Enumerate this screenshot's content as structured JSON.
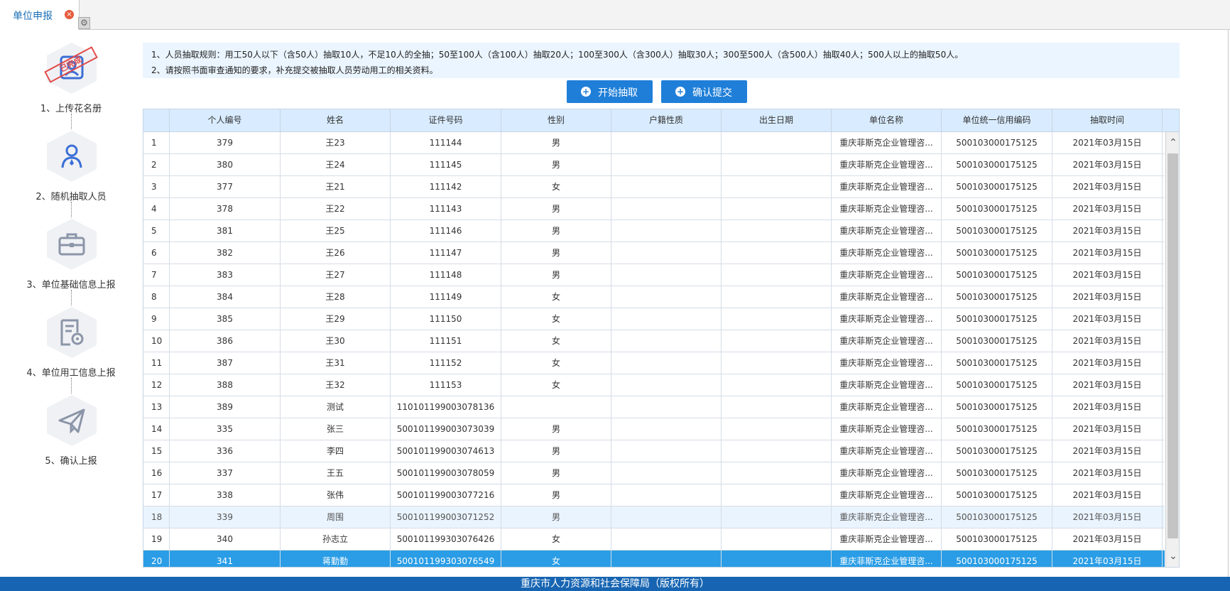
{
  "tab": {
    "title": "单位申报",
    "close": "×",
    "gear": "⚙"
  },
  "steps": [
    {
      "label": "1、上传花名册",
      "icon": "upload-roster-icon",
      "stamp": "已完成"
    },
    {
      "label": "2、随机抽取人员",
      "icon": "person-icon"
    },
    {
      "label": "3、单位基础信息上报",
      "icon": "briefcase-icon"
    },
    {
      "label": "4、单位用工信息上报",
      "icon": "document-gear-icon"
    },
    {
      "label": "5、确认上报",
      "icon": "send-icon"
    }
  ],
  "notice": {
    "line1": "1、人员抽取规则：用工50人以下（含50人）抽取10人，不足10人的全抽；50至100人（含100人）抽取20人；100至300人（含300人）抽取30人；300至500人（含500人）抽取40人；500人以上的抽取50人。",
    "line2": "2、请按照书面审查通知的要求，补充提交被抽取人员劳动用工的相关资料。"
  },
  "buttons": {
    "start": "开始抽取",
    "confirm": "确认提交",
    "plus": "+"
  },
  "columns": [
    "",
    "个人编号",
    "姓名",
    "证件号码",
    "性别",
    "户籍性质",
    "出生日期",
    "单位名称",
    "单位统一信用编码",
    "抽取时间"
  ],
  "rows": [
    [
      "1",
      "379",
      "王23",
      "111144",
      "男",
      "",
      "",
      "重庆菲斯克企业管理咨...",
      "500103000175125",
      "2021年03月15日"
    ],
    [
      "2",
      "380",
      "王24",
      "111145",
      "男",
      "",
      "",
      "重庆菲斯克企业管理咨...",
      "500103000175125",
      "2021年03月15日"
    ],
    [
      "3",
      "377",
      "王21",
      "111142",
      "女",
      "",
      "",
      "重庆菲斯克企业管理咨...",
      "500103000175125",
      "2021年03月15日"
    ],
    [
      "4",
      "378",
      "王22",
      "111143",
      "男",
      "",
      "",
      "重庆菲斯克企业管理咨...",
      "500103000175125",
      "2021年03月15日"
    ],
    [
      "5",
      "381",
      "王25",
      "111146",
      "男",
      "",
      "",
      "重庆菲斯克企业管理咨...",
      "500103000175125",
      "2021年03月15日"
    ],
    [
      "6",
      "382",
      "王26",
      "111147",
      "男",
      "",
      "",
      "重庆菲斯克企业管理咨...",
      "500103000175125",
      "2021年03月15日"
    ],
    [
      "7",
      "383",
      "王27",
      "111148",
      "男",
      "",
      "",
      "重庆菲斯克企业管理咨...",
      "500103000175125",
      "2021年03月15日"
    ],
    [
      "8",
      "384",
      "王28",
      "111149",
      "女",
      "",
      "",
      "重庆菲斯克企业管理咨...",
      "500103000175125",
      "2021年03月15日"
    ],
    [
      "9",
      "385",
      "王29",
      "111150",
      "女",
      "",
      "",
      "重庆菲斯克企业管理咨...",
      "500103000175125",
      "2021年03月15日"
    ],
    [
      "10",
      "386",
      "王30",
      "111151",
      "女",
      "",
      "",
      "重庆菲斯克企业管理咨...",
      "500103000175125",
      "2021年03月15日"
    ],
    [
      "11",
      "387",
      "王31",
      "111152",
      "女",
      "",
      "",
      "重庆菲斯克企业管理咨...",
      "500103000175125",
      "2021年03月15日"
    ],
    [
      "12",
      "388",
      "王32",
      "111153",
      "女",
      "",
      "",
      "重庆菲斯克企业管理咨...",
      "500103000175125",
      "2021年03月15日"
    ],
    [
      "13",
      "389",
      "测试",
      "110101199003078136",
      "",
      "",
      "",
      "重庆菲斯克企业管理咨...",
      "500103000175125",
      "2021年03月15日"
    ],
    [
      "14",
      "335",
      "张三",
      "500101199003073039",
      "男",
      "",
      "",
      "重庆菲斯克企业管理咨...",
      "500103000175125",
      "2021年03月15日"
    ],
    [
      "15",
      "336",
      "李四",
      "500101199003074613",
      "男",
      "",
      "",
      "重庆菲斯克企业管理咨...",
      "500103000175125",
      "2021年03月15日"
    ],
    [
      "16",
      "337",
      "王五",
      "500101199003078059",
      "男",
      "",
      "",
      "重庆菲斯克企业管理咨...",
      "500103000175125",
      "2021年03月15日"
    ],
    [
      "17",
      "338",
      "张伟",
      "500101199003077216",
      "男",
      "",
      "",
      "重庆菲斯克企业管理咨...",
      "500103000175125",
      "2021年03月15日"
    ],
    [
      "18",
      "339",
      "周围",
      "500101199003071252",
      "男",
      "",
      "",
      "重庆菲斯克企业管理咨...",
      "500103000175125",
      "2021年03月15日"
    ],
    [
      "19",
      "340",
      "孙志立",
      "500101199303076426",
      "女",
      "",
      "",
      "重庆菲斯克企业管理咨...",
      "500103000175125",
      "2021年03月15日"
    ],
    [
      "20",
      "341",
      "蒋勤勤",
      "500101199303076549",
      "女",
      "",
      "",
      "重庆菲斯克企业管理咨...",
      "500103000175125",
      "2021年03月15日"
    ]
  ],
  "scroll": {
    "up": "⌃",
    "down": "⌄"
  },
  "footer": "重庆市人力资源和社会保障局（版权所有）",
  "colors": {
    "accent": "#1f7fd8",
    "header_bg": "#d9ecff",
    "selected_row": "#2a9de6",
    "footer_bg": "#1765b2",
    "stamp": "#e24a4a"
  }
}
